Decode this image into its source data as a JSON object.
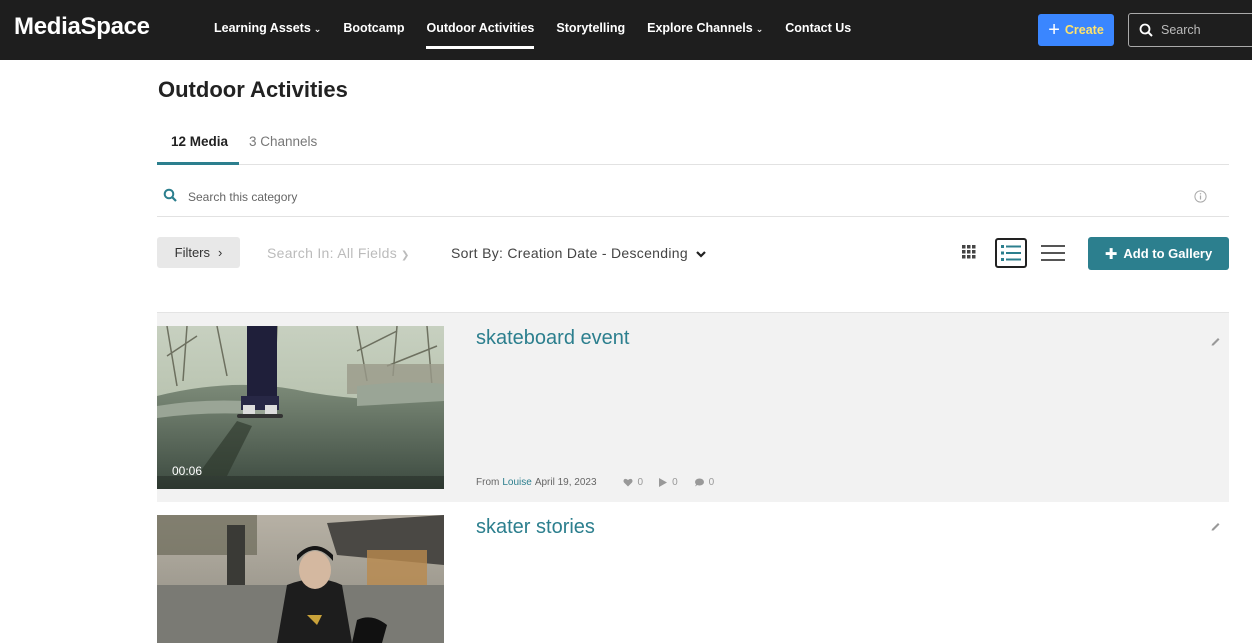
{
  "nav": {
    "logo": "MediaSpace",
    "items": [
      {
        "label": "Learning Assets",
        "chevron": "⌄"
      },
      {
        "label": "Bootcamp",
        "chevron": ""
      },
      {
        "label": "Outdoor Activities",
        "chevron": ""
      },
      {
        "label": "Storytelling",
        "chevron": ""
      },
      {
        "label": "Explore Channels",
        "chevron": "⌄"
      },
      {
        "label": "Contact Us",
        "chevron": ""
      }
    ],
    "create_label": "Create",
    "search_placeholder": "Search"
  },
  "page": {
    "title": "Outdoor Activities",
    "tabs": [
      {
        "label": "12 Media"
      },
      {
        "label": "3 Channels"
      }
    ]
  },
  "category_search": {
    "placeholder": "Search this category"
  },
  "toolbar": {
    "filters_label": "Filters",
    "filters_chevron": "›",
    "search_in_label": "Search In: All Fields",
    "sort_label": "Sort By: Creation Date - Descending",
    "add_gallery_label": "Add to Gallery"
  },
  "entries": [
    {
      "title": "skateboard event",
      "duration": "00:06",
      "from_label": "From",
      "author": "Louise",
      "date": "April 19, 2023",
      "likes": "0",
      "plays": "0",
      "comments": "0"
    },
    {
      "title": "skater stories"
    }
  ],
  "colors": {
    "accent": "#2c7f8e",
    "topbar": "#1e1e1e",
    "create_button": "#3a86ff"
  }
}
